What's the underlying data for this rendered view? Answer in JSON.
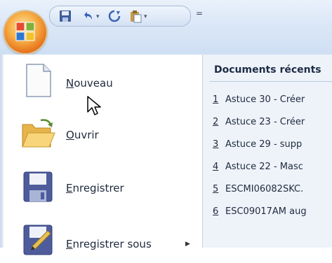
{
  "menu": {
    "items": [
      {
        "label_ul": "N",
        "label_rest": "ouveau",
        "icon": "new-document-icon"
      },
      {
        "label_ul": "O",
        "label_rest": "uvrir",
        "icon": "open-folder-icon"
      },
      {
        "label_ul": "E",
        "label_rest": "nregistrer",
        "icon": "save-icon"
      },
      {
        "label_ul": "E",
        "label_rest": "nregistrer sous",
        "icon": "save-as-icon"
      }
    ]
  },
  "recent": {
    "title": "Documents récents",
    "items": [
      {
        "num": "1",
        "name": "Astuce 30 - Créer"
      },
      {
        "num": "2",
        "name": "Astuce 23 - Créer"
      },
      {
        "num": "3",
        "name": "Astuce 29 - supp"
      },
      {
        "num": "4",
        "name": "Astuce 22 - Masc"
      },
      {
        "num": "5",
        "name": "ESCMI06082SKC."
      },
      {
        "num": "6",
        "name": "ESC09017AM aug"
      }
    ]
  },
  "qat": {
    "more_glyph": "="
  }
}
